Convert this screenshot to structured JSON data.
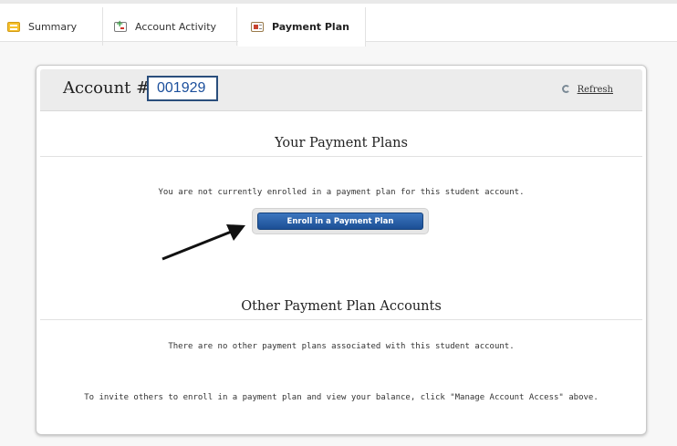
{
  "tabs": [
    {
      "label": "Summary",
      "icon": "summary-icon"
    },
    {
      "label": "Account Activity",
      "icon": "account-activity-icon"
    },
    {
      "label": "Payment Plan",
      "icon": "payment-plan-icon",
      "active": true
    }
  ],
  "account": {
    "label": "Account #",
    "number": "001929",
    "refresh_label": "Refresh"
  },
  "payment_plans": {
    "title": "Your Payment Plans",
    "message": "You are not currently enrolled in a payment plan for this student account.",
    "enroll_button": "Enroll in a Payment Plan"
  },
  "other_accounts": {
    "title": "Other Payment Plan Accounts",
    "message": "There are no other payment plans associated with this student account.",
    "invite_message": "To invite others to enroll in a payment plan and view your balance, click \"Manage Account Access\" above."
  },
  "colors": {
    "accent": "#1c4f95",
    "account_number": "#1b4f9c"
  }
}
